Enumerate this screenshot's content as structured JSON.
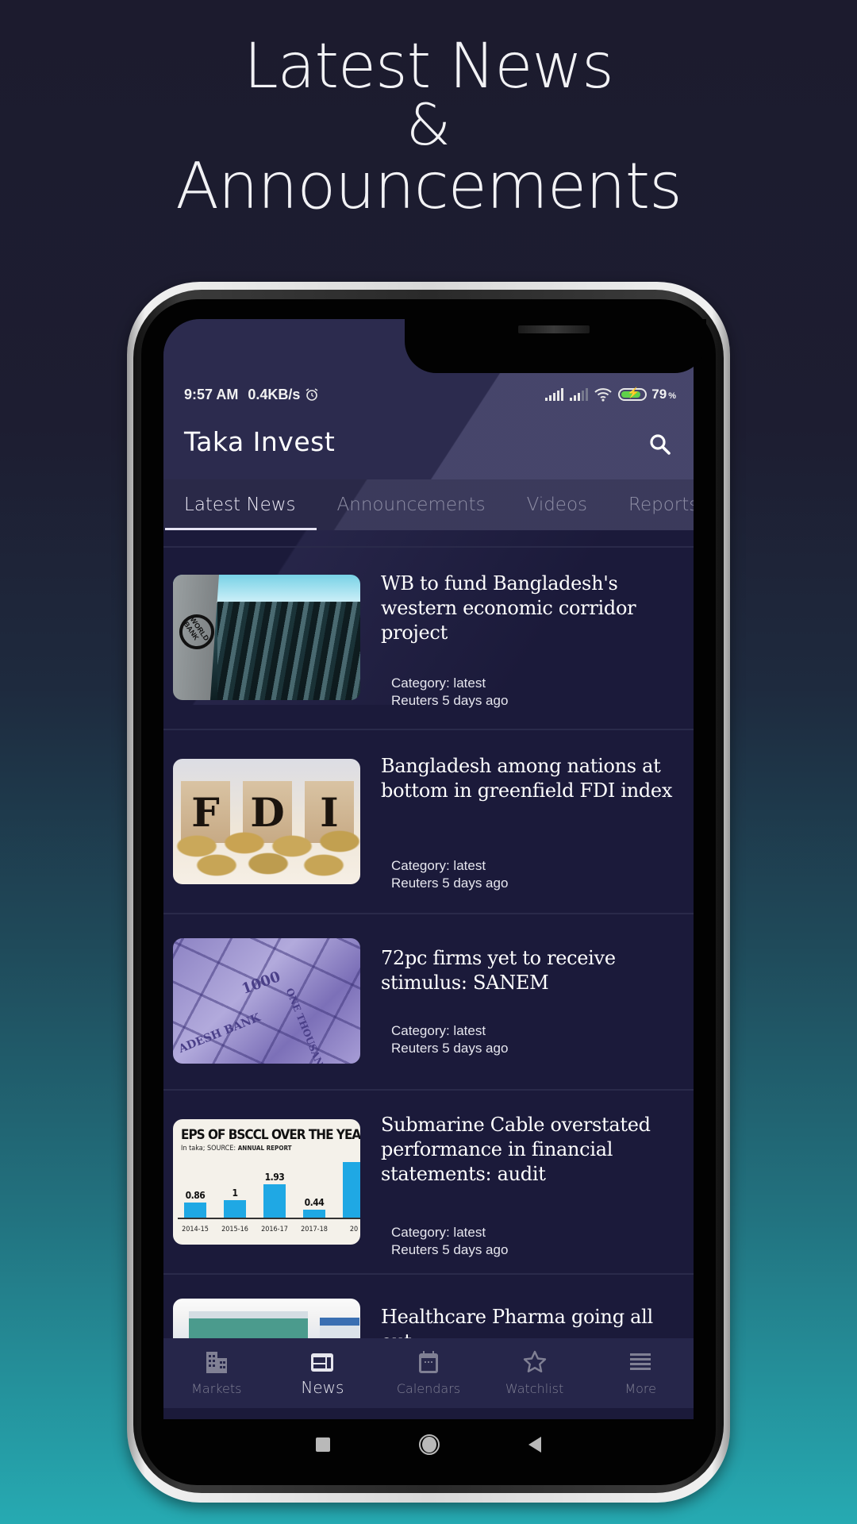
{
  "promo": {
    "line1": "Latest News",
    "line2": "&",
    "line3": "Announcements"
  },
  "statusbar": {
    "time": "9:57 AM",
    "network_speed": "0.4KB/s",
    "alarm_icon": "alarm-clock-icon",
    "signal_icons": [
      "signal-sim1-icon",
      "signal-sim2-icon"
    ],
    "wifi_icon": "wifi-icon",
    "battery_icon": "battery-charging-icon",
    "battery_percent": "79",
    "battery_unit": "%"
  },
  "header": {
    "title": "Taka Invest",
    "search_icon": "search-icon"
  },
  "tabs": [
    {
      "label": "Latest News",
      "active": true
    },
    {
      "label": "Announcements",
      "active": false
    },
    {
      "label": "Videos",
      "active": false
    },
    {
      "label": "Reports",
      "active": false
    }
  ],
  "news": [
    {
      "headline": "WB to fund Bangladesh's western economic corridor project",
      "category": "Category: latest",
      "source_time": "Reuters 5 days ago",
      "thumb_text": "WORLD BANK"
    },
    {
      "headline": "Bangladesh among nations at bottom in greenfield FDI index",
      "category": "Category: latest",
      "source_time": "Reuters 5 days ago",
      "thumb_text": [
        "F",
        "D",
        "I"
      ]
    },
    {
      "headline": "72pc firms yet to receive stimulus: SANEM",
      "category": "Category: latest",
      "source_time": "Reuters 5 days ago",
      "thumb_text": [
        "1000",
        "ADESH BANK",
        "ONE THOUSAND"
      ]
    },
    {
      "headline": "Submarine Cable overstated performance in financial statements: audit",
      "category": "Category: latest",
      "source_time": "Reuters 5 days ago",
      "thumb_chart": {
        "title": "EPS OF BSCCL OVER THE YEARS",
        "subtitle": "In taka; SOURCE:",
        "source": "ANNUAL REPORT",
        "categories": [
          "2014-15",
          "2015-16",
          "2016-17",
          "2017-18",
          "20"
        ],
        "values": [
          "0.86",
          "1",
          "1.93",
          "0.44",
          "3"
        ]
      }
    },
    {
      "headline": "Healthcare Pharma going all out",
      "category": "",
      "source_time": ""
    }
  ],
  "bottom_nav": [
    {
      "label": "Markets",
      "icon": "building-icon",
      "active": false
    },
    {
      "label": "News",
      "icon": "newspaper-icon",
      "active": true
    },
    {
      "label": "Calendars",
      "icon": "calendar-icon",
      "active": false
    },
    {
      "label": "Watchlist",
      "icon": "star-icon",
      "active": false
    },
    {
      "label": "More",
      "icon": "menu-icon",
      "active": false
    }
  ],
  "android_nav": [
    "recents-button",
    "home-button",
    "back-button"
  ]
}
